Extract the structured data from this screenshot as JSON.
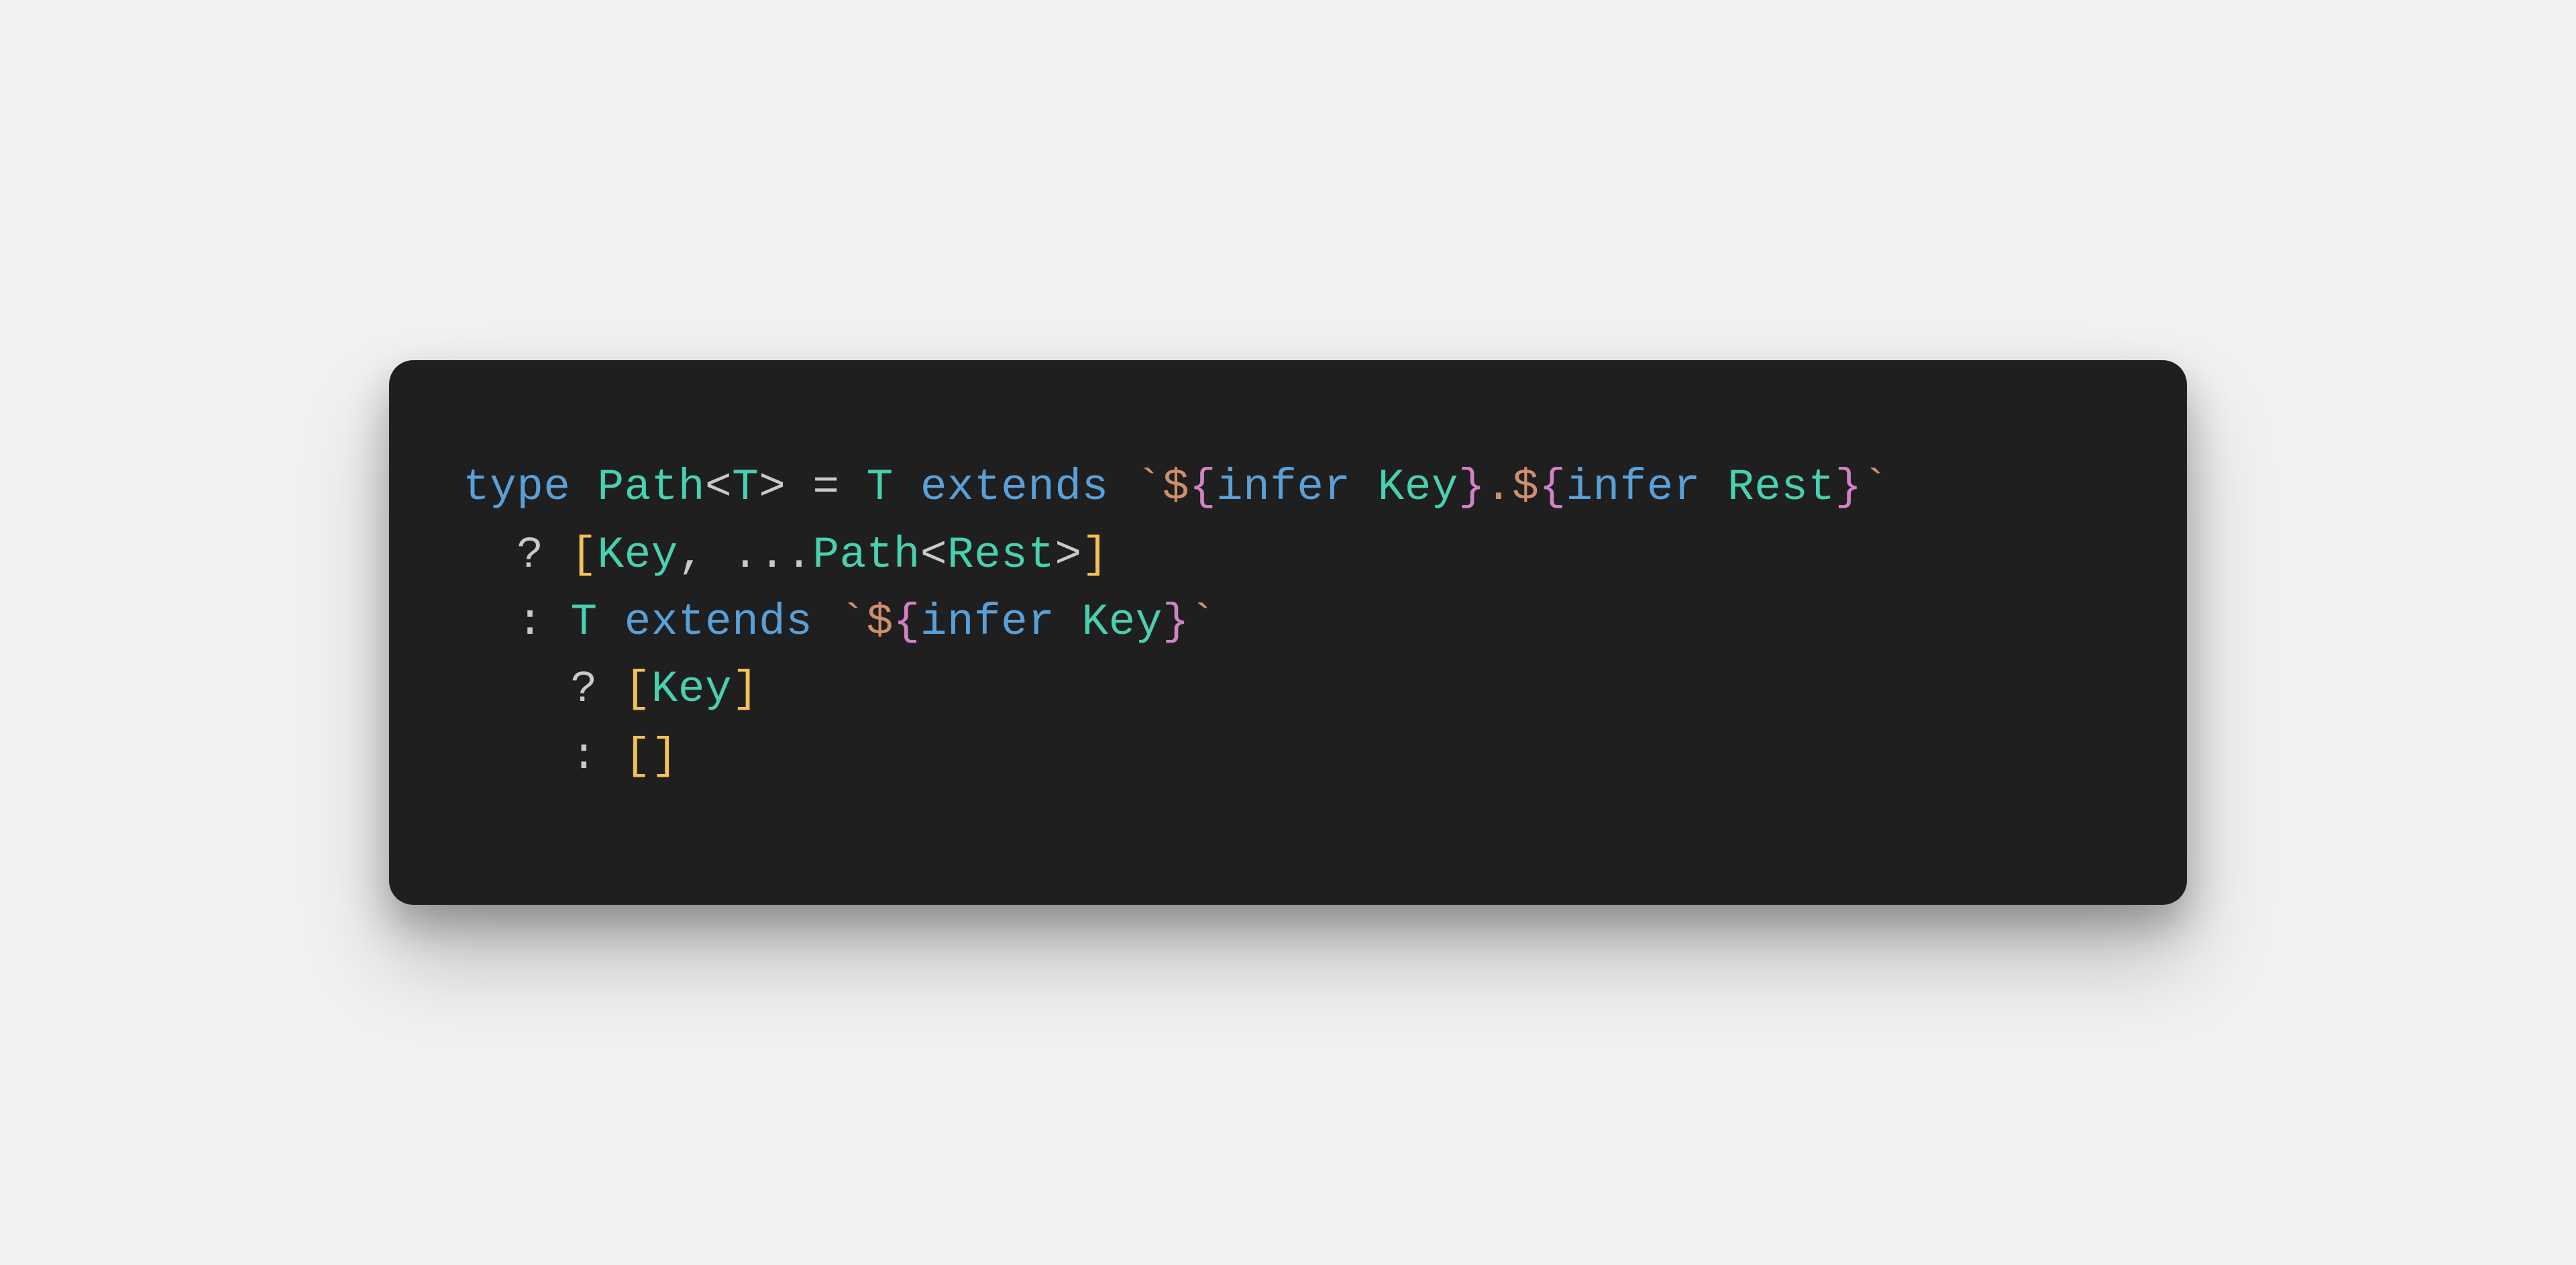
{
  "code": {
    "lines": [
      {
        "indent": "",
        "tokens": [
          {
            "t": "type ",
            "c": "tok-keyword"
          },
          {
            "t": "Path",
            "c": "tok-typename"
          },
          {
            "t": "<",
            "c": "tok-punc"
          },
          {
            "t": "T",
            "c": "tok-typevar"
          },
          {
            "t": ">",
            "c": "tok-punc"
          },
          {
            "t": " = ",
            "c": "tok-punc"
          },
          {
            "t": "T",
            "c": "tok-typevar"
          },
          {
            "t": " extends ",
            "c": "tok-keyword"
          },
          {
            "t": "`",
            "c": "tok-stringlit"
          },
          {
            "t": "$",
            "c": "tok-stringlit"
          },
          {
            "t": "{",
            "c": "tok-brace"
          },
          {
            "t": "infer ",
            "c": "tok-keyword"
          },
          {
            "t": "Key",
            "c": "tok-typename"
          },
          {
            "t": "}",
            "c": "tok-brace"
          },
          {
            "t": ".",
            "c": "tok-stringlit"
          },
          {
            "t": "$",
            "c": "tok-stringlit"
          },
          {
            "t": "{",
            "c": "tok-brace"
          },
          {
            "t": "infer ",
            "c": "tok-keyword"
          },
          {
            "t": "Rest",
            "c": "tok-typename"
          },
          {
            "t": "}",
            "c": "tok-brace"
          },
          {
            "t": "`",
            "c": "tok-stringlit"
          }
        ]
      },
      {
        "indent": "  ",
        "tokens": [
          {
            "t": "? ",
            "c": "tok-punc"
          },
          {
            "t": "[",
            "c": "tok-bracket"
          },
          {
            "t": "Key",
            "c": "tok-typename"
          },
          {
            "t": ", ",
            "c": "tok-punc"
          },
          {
            "t": "...",
            "c": "tok-punc"
          },
          {
            "t": "Path",
            "c": "tok-typename"
          },
          {
            "t": "<",
            "c": "tok-punc"
          },
          {
            "t": "Rest",
            "c": "tok-typename"
          },
          {
            "t": ">",
            "c": "tok-punc"
          },
          {
            "t": "]",
            "c": "tok-bracket"
          }
        ]
      },
      {
        "indent": "  ",
        "tokens": [
          {
            "t": ": ",
            "c": "tok-punc"
          },
          {
            "t": "T",
            "c": "tok-typevar"
          },
          {
            "t": " extends ",
            "c": "tok-keyword"
          },
          {
            "t": "`",
            "c": "tok-stringlit"
          },
          {
            "t": "$",
            "c": "tok-stringlit"
          },
          {
            "t": "{",
            "c": "tok-brace"
          },
          {
            "t": "infer ",
            "c": "tok-keyword"
          },
          {
            "t": "Key",
            "c": "tok-typename"
          },
          {
            "t": "}",
            "c": "tok-brace"
          },
          {
            "t": "`",
            "c": "tok-stringlit"
          }
        ]
      },
      {
        "indent": "    ",
        "tokens": [
          {
            "t": "? ",
            "c": "tok-punc"
          },
          {
            "t": "[",
            "c": "tok-bracket"
          },
          {
            "t": "Key",
            "c": "tok-typename"
          },
          {
            "t": "]",
            "c": "tok-bracket"
          }
        ]
      },
      {
        "indent": "    ",
        "tokens": [
          {
            "t": ": ",
            "c": "tok-punc"
          },
          {
            "t": "[",
            "c": "tok-bracket"
          },
          {
            "t": "]",
            "c": "tok-bracket"
          }
        ]
      }
    ]
  }
}
